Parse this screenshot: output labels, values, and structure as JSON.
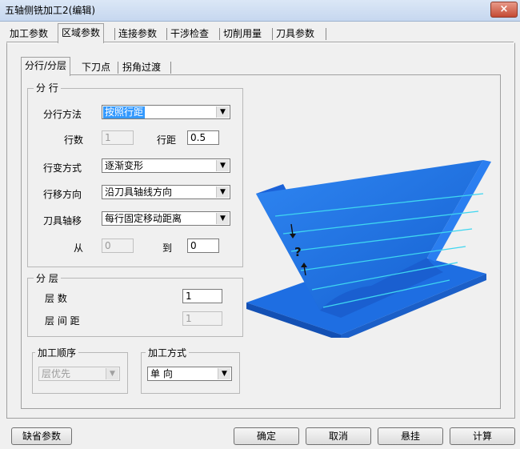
{
  "window": {
    "title": "五轴侧铣加工2(编辑)",
    "close_glyph": "×"
  },
  "tabs": [
    "加工参数",
    "区域参数",
    "连接参数",
    "干涉检查",
    "切削用量",
    "刀具参数"
  ],
  "sub_tabs": [
    "分行/分层",
    "下刀点",
    "拐角过渡"
  ],
  "row_group": {
    "legend": "分 行",
    "method_label": "分行方法",
    "method_value": "按照行距",
    "rows_label": "行数",
    "rows_value": "1",
    "spacing_label": "行距",
    "spacing_value": "0.5",
    "transform_label": "行变方式",
    "transform_value": "逐渐变形",
    "direction_label": "行移方向",
    "direction_value": "沿刀具轴线方向",
    "axis_shift_label": "刀具轴移",
    "axis_shift_value": "每行固定移动距离",
    "from_label": "从",
    "from_value": "0",
    "to_label": "到",
    "to_value": "0"
  },
  "layer_group": {
    "legend": "分 层",
    "count_label": "层  数",
    "count_value": "1",
    "spacing_label": "层 间 距",
    "spacing_value": "1"
  },
  "order_group": {
    "legend": "加工顺序",
    "value": "层优先"
  },
  "mode_group": {
    "legend": "加工方式",
    "value": "单 向"
  },
  "illustration": {
    "annotation": "?"
  },
  "buttons": {
    "defaults": "缺省参数",
    "ok": "确定",
    "cancel": "取消",
    "suspend": "悬挂",
    "compute": "计算"
  },
  "colors": {
    "part": "#1f6fe0",
    "toolpath": "#3fd6f0"
  }
}
